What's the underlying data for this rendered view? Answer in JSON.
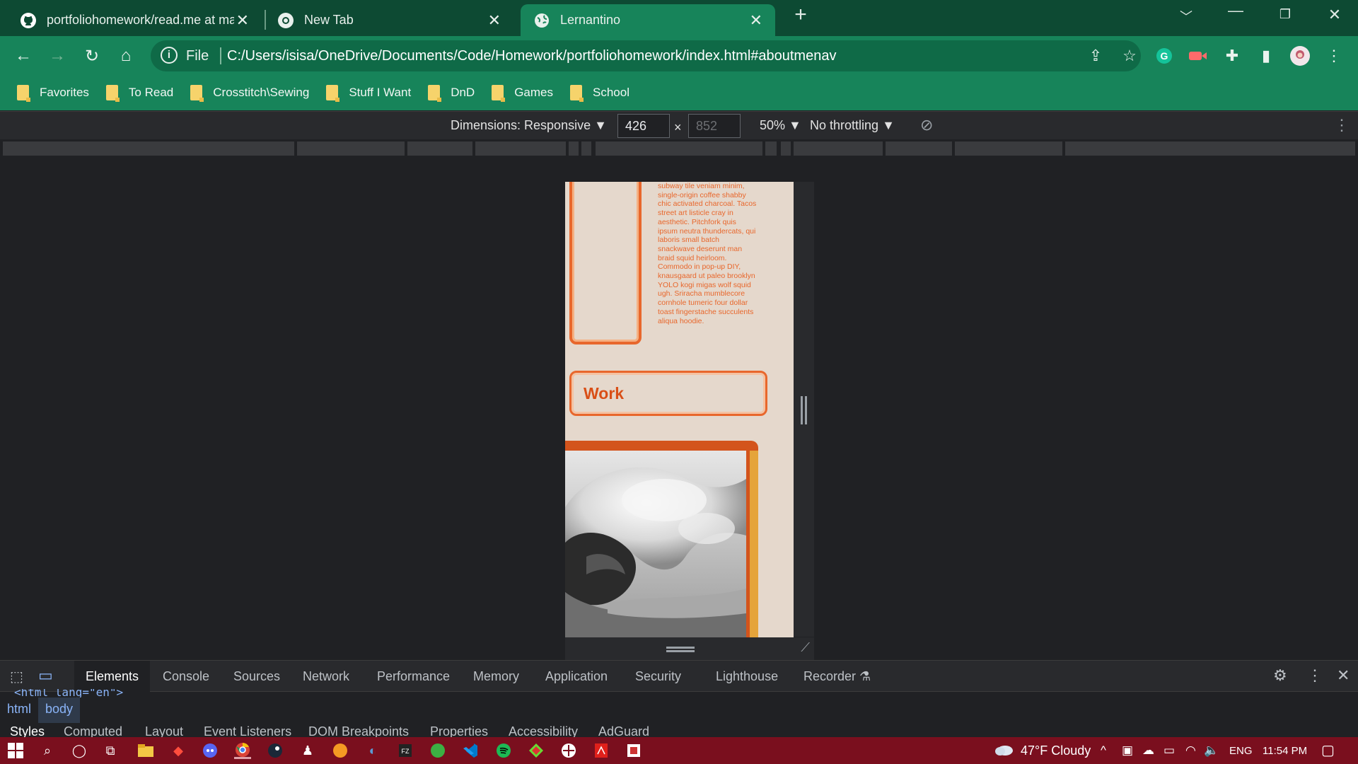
{
  "browser": {
    "tabs": [
      {
        "title": "portfoliohomework/read.me at main",
        "icon": "github-icon"
      },
      {
        "title": "New Tab",
        "icon": "chrome-icon"
      },
      {
        "title": "Lernantino",
        "icon": "globe-icon"
      }
    ],
    "address": {
      "scheme": "File",
      "url": "C:/Users/isisa/OneDrive/Documents/Code/Homework/portfoliohomework/index.html#aboutmenav"
    },
    "bookmarks": [
      "Favorites",
      "To Read",
      "Crosstitch\\Sewing",
      "Stuff I Want",
      "DnD",
      "Games",
      "School"
    ]
  },
  "device_toolbar": {
    "dimensions_label": "Dimensions: Responsive",
    "width": "426",
    "height": "852",
    "times": "×",
    "zoom": "50%",
    "throttling": "No throttling"
  },
  "page": {
    "lorem": "subway tile veniam minim, single-origin coffee shabby chic activated charcoal. Tacos street art listicle cray in aesthetic. Pitchfork quis ipsum neutra thundercats, qui laboris small batch snackwave deserunt man braid squid heirloom. Commodo in pop-up DIY, knausgaard ut paleo brooklyn YOLO kogi migas wolf squid ugh. Sriracha mumblecore cornhole tumeric four dollar toast fingerstache succulents aliqua hoodie.",
    "work_heading": "Work"
  },
  "devtools": {
    "tabs": [
      "Elements",
      "Console",
      "Sources",
      "Network",
      "Performance",
      "Memory",
      "Application",
      "Security",
      "Lighthouse",
      "Recorder"
    ],
    "crumbs": [
      "html",
      "body"
    ],
    "code_line": "<html lang=\"en\">",
    "subtabs": [
      "Styles",
      "Computed",
      "Layout",
      "Event Listeners",
      "DOM Breakpoints",
      "Properties",
      "Accessibility",
      "AdGuard"
    ]
  },
  "taskbar": {
    "weather": "47°F  Cloudy",
    "language": "ENG",
    "time": "11:54 PM"
  },
  "colors": {
    "chrome_frame": "#0d4a33",
    "toolbar": "#17845a",
    "page_bg": "#e5d8cc",
    "accent_orange": "#e8672c",
    "taskbar": "#7a0f1e"
  }
}
